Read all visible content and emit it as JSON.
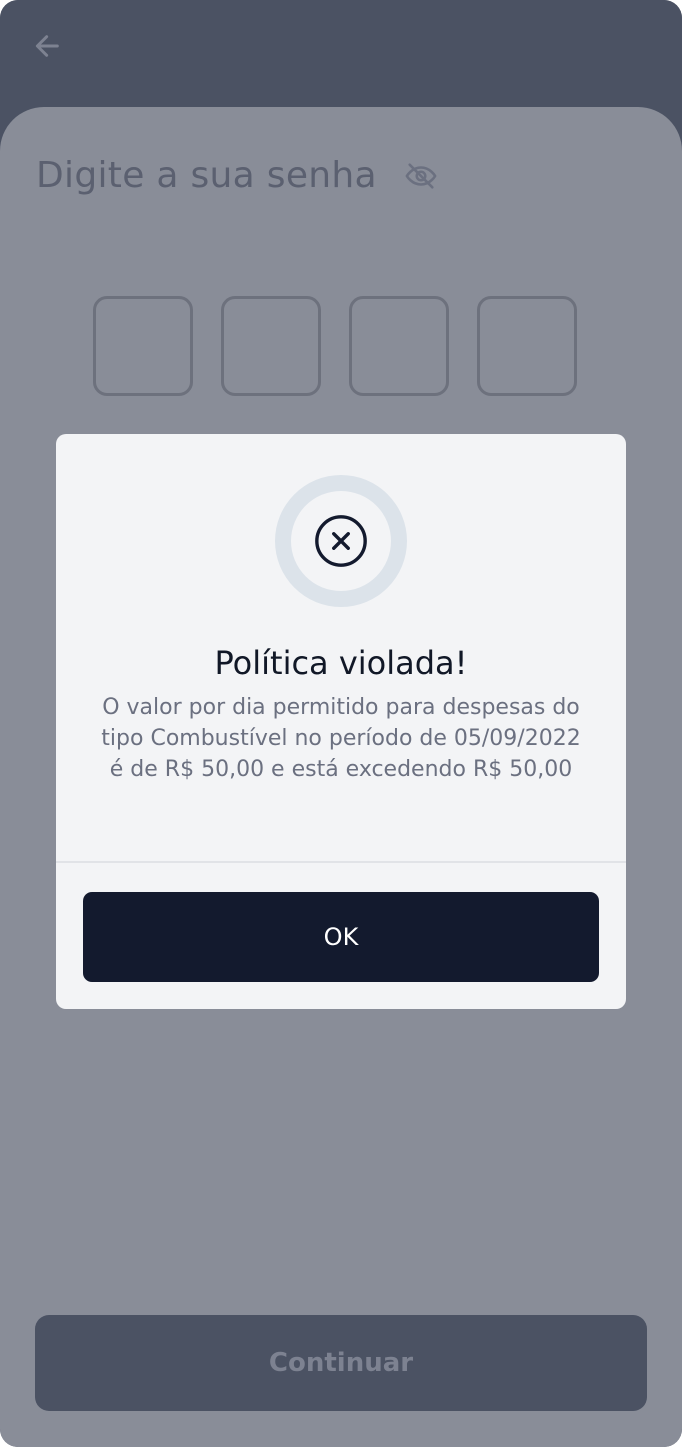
{
  "header": {
    "back_icon": "arrow-left-icon"
  },
  "password_screen": {
    "title": "Digite a sua senha",
    "visibility_icon": "eye-off-icon",
    "pin_length": 4,
    "continue_label": "Continuar"
  },
  "dialog": {
    "icon": "x-circle-icon",
    "title": "Política violada!",
    "message": "O valor por dia permitido para despesas do tipo Combustível no período de 05/09/2022 é de R$ 50,00 e está excedendo R$ 50,00",
    "ok_label": "OK"
  },
  "colors": {
    "overlay_dark": "#4b5263",
    "overlay_sheet": "#898d98",
    "dialog_background": "#f3f4f6",
    "primary_button": "#131a2e",
    "icon_ring": "#dce3ea"
  }
}
